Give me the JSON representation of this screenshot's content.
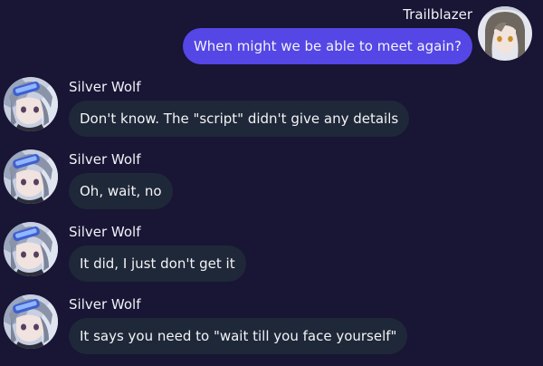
{
  "colors": {
    "background": "#181535",
    "outgoing_bubble": "#5546e6",
    "incoming_bubble": "#1f2838",
    "text": "#f3f3f7"
  },
  "messages": [
    {
      "direction": "outgoing",
      "sender": "Trailblazer",
      "avatar": "trailblazer-avatar",
      "text": "When might we be able to meet again?"
    },
    {
      "direction": "incoming",
      "sender": "Silver Wolf",
      "avatar": "silver-wolf-avatar",
      "text": "Don't know. The \"script\" didn't give any details"
    },
    {
      "direction": "incoming",
      "sender": "Silver Wolf",
      "avatar": "silver-wolf-avatar",
      "text": "Oh, wait, no"
    },
    {
      "direction": "incoming",
      "sender": "Silver Wolf",
      "avatar": "silver-wolf-avatar",
      "text": "It did, I just don't get it"
    },
    {
      "direction": "incoming",
      "sender": "Silver Wolf",
      "avatar": "silver-wolf-avatar",
      "text": "It says you need to \"wait till you face yourself\""
    }
  ]
}
